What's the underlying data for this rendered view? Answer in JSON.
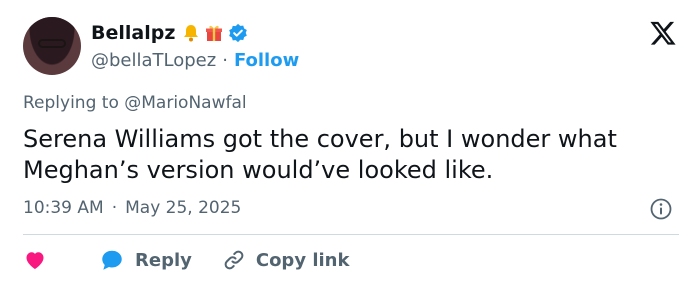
{
  "author": {
    "display_name": "Bellalpz",
    "handle": "@bellaTLopez",
    "separator": "·",
    "follow_label": "Follow",
    "badges": [
      "bell-emoji",
      "gift-emoji",
      "verified-badge"
    ]
  },
  "reply_context": {
    "prefix": "Replying to",
    "mention": "@MarioNawfal"
  },
  "tweet": {
    "text": "Serena Williams got the cover, but I wonder what Meghan’s version would’ve looked like.",
    "time": "10:39 AM",
    "separator": "·",
    "date": "May 25, 2025"
  },
  "actions": {
    "like_icon": "heart-icon",
    "reply_label": "Reply",
    "copy_link_label": "Copy link"
  },
  "colors": {
    "accent": "#1d9bf0",
    "heart": "#f91880",
    "text": "#0f1419",
    "muted": "#536471",
    "divider": "#cfd9de"
  }
}
